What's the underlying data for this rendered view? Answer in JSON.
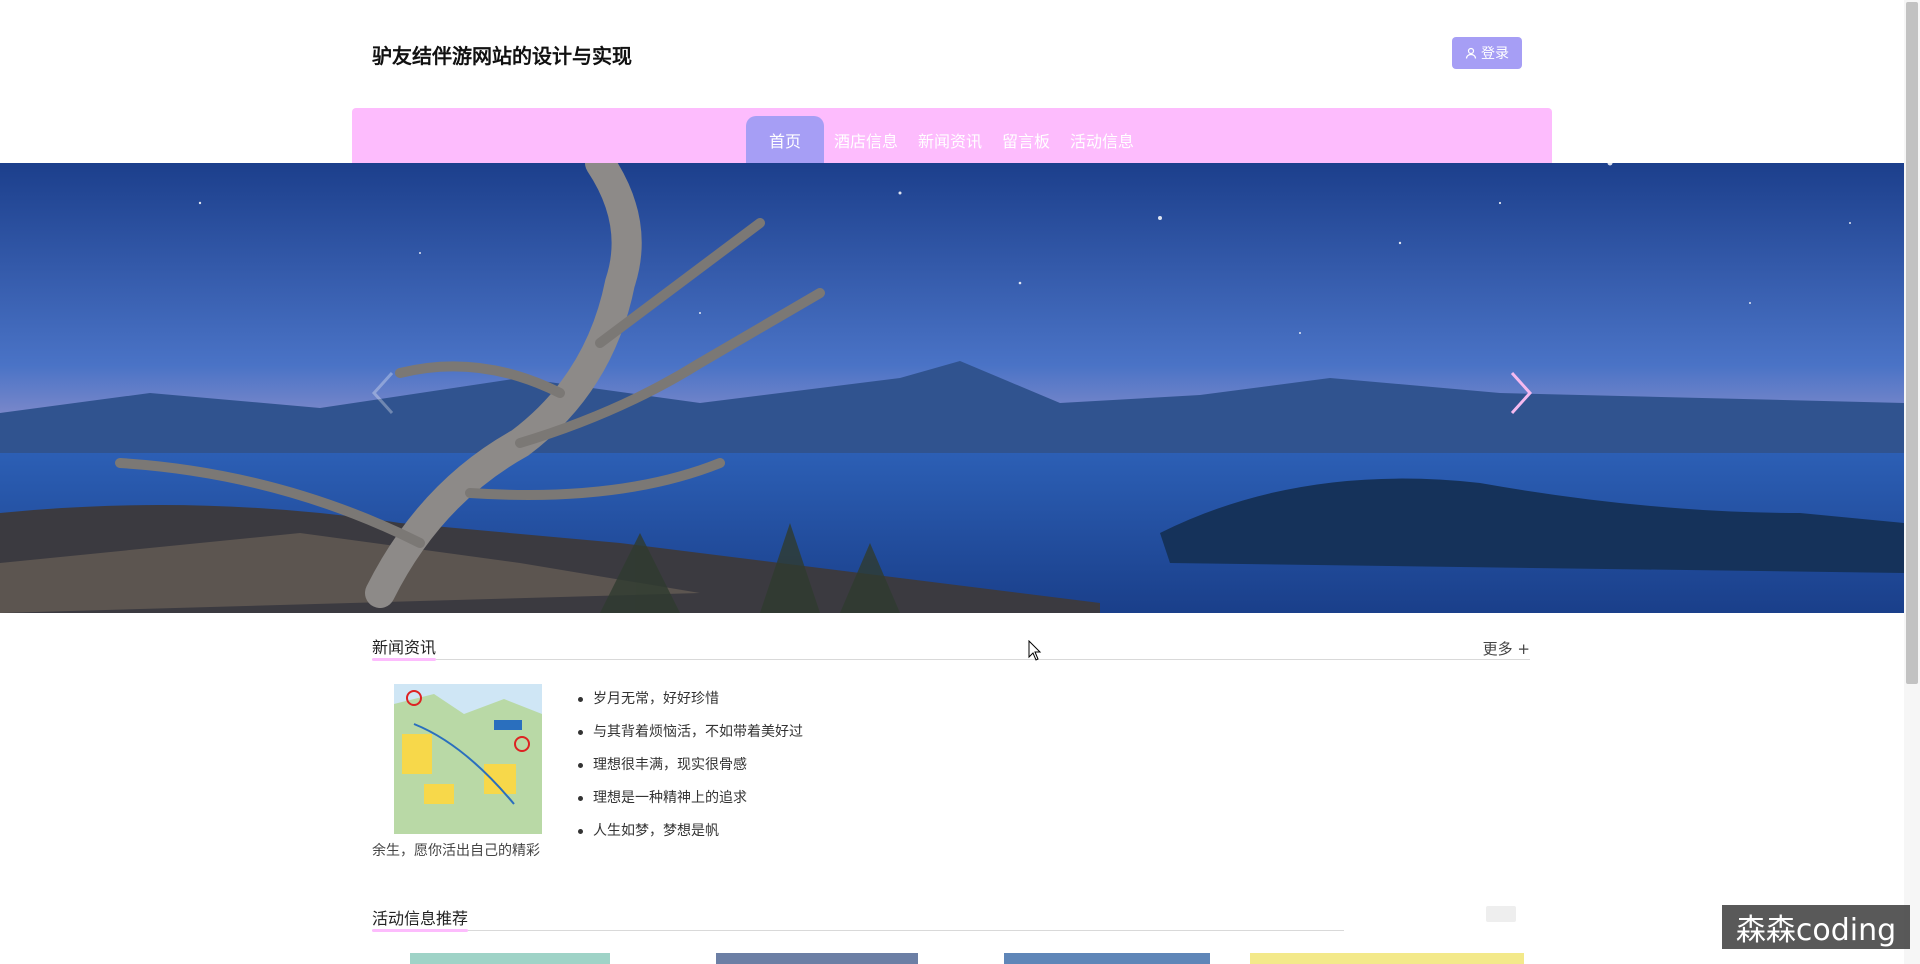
{
  "header": {
    "site_title": "驴友结伴游网站的设计与实现",
    "login_label": "登录"
  },
  "nav": {
    "items": [
      {
        "label": "首页",
        "active": true
      },
      {
        "label": "酒店信息",
        "active": false
      },
      {
        "label": "新闻资讯",
        "active": false
      },
      {
        "label": "留言板",
        "active": false
      },
      {
        "label": "活动信息",
        "active": false
      }
    ]
  },
  "news": {
    "title": "新闻资讯",
    "more": "更多 +",
    "featured_caption": "余生，愿你活出自己的精彩",
    "items": [
      "岁月无常，好好珍惜",
      "与其背着烦恼活，不如带着美好过",
      "理想很丰满，现实很骨感",
      "理想是一种精神上的追求",
      "人生如梦，梦想是帆"
    ]
  },
  "activity": {
    "title": "活动信息推荐"
  },
  "watermark": "森森coding",
  "colors": {
    "nav_bg": "#fdbcfd",
    "accent": "#a69ef5"
  }
}
